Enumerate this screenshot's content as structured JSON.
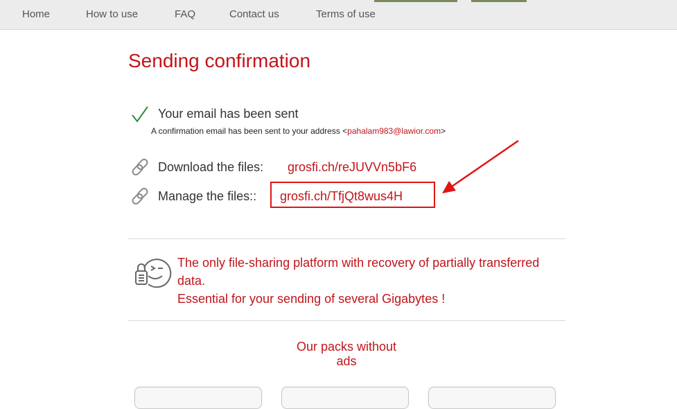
{
  "nav": {
    "items": [
      {
        "label": "Home"
      },
      {
        "label": "How to use"
      },
      {
        "label": "FAQ"
      },
      {
        "label": "Contact us"
      },
      {
        "label": "Terms of use"
      }
    ]
  },
  "page": {
    "title": "Sending confirmation"
  },
  "confirmation": {
    "title": "Your email has been sent",
    "detail_prefix": "A confirmation email has been sent to your address <",
    "email": "pahalam983@lawior.com",
    "detail_suffix": ">"
  },
  "links": {
    "download_label": "Download the files:",
    "download_url": "grosfi.ch/reJUVVn5bF6",
    "manage_label": "Manage the files::",
    "manage_url": "grosfi.ch/TfjQt8wus4H"
  },
  "promo": {
    "line1": "The only file-sharing platform with recovery of partially transferred data.",
    "line2": "Essential for your sending of several Gigabytes !"
  },
  "packs": {
    "title": "Our packs without ads"
  },
  "colors": {
    "accent_red": "#c0151b",
    "annotation_red": "#e01414",
    "check_green": "#2e8b3d"
  }
}
